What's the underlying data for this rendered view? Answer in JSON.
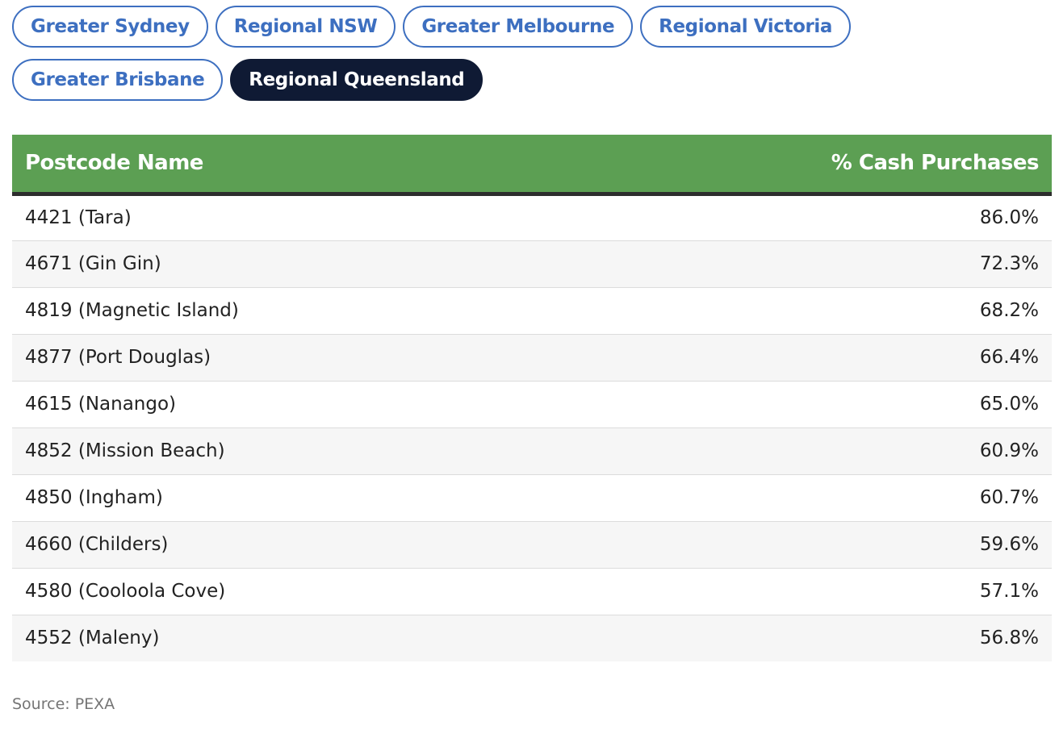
{
  "region_tabs": [
    {
      "label": "Greater Sydney",
      "active": false
    },
    {
      "label": "Regional NSW",
      "active": false
    },
    {
      "label": "Greater Melbourne",
      "active": false
    },
    {
      "label": "Regional Victoria",
      "active": false
    },
    {
      "label": "Greater Brisbane",
      "active": false
    },
    {
      "label": "Regional Queensland",
      "active": true
    }
  ],
  "table": {
    "headers": {
      "postcode_name": "Postcode Name",
      "cash_purchases": "% Cash Purchases"
    },
    "rows": [
      {
        "postcode_name": "4421 (Tara)",
        "cash_purchases": "86.0%"
      },
      {
        "postcode_name": "4671 (Gin Gin)",
        "cash_purchases": "72.3%"
      },
      {
        "postcode_name": "4819 (Magnetic Island)",
        "cash_purchases": "68.2%"
      },
      {
        "postcode_name": "4877 (Port Douglas)",
        "cash_purchases": "66.4%"
      },
      {
        "postcode_name": "4615 (Nanango)",
        "cash_purchases": "65.0%"
      },
      {
        "postcode_name": "4852 (Mission Beach)",
        "cash_purchases": "60.9%"
      },
      {
        "postcode_name": "4850 (Ingham)",
        "cash_purchases": "60.7%"
      },
      {
        "postcode_name": "4660 (Childers)",
        "cash_purchases": "59.6%"
      },
      {
        "postcode_name": "4580 (Cooloola Cove)",
        "cash_purchases": "57.1%"
      },
      {
        "postcode_name": "4552 (Maleny)",
        "cash_purchases": "56.8%"
      }
    ]
  },
  "source": "Source: PEXA",
  "colors": {
    "tab_text": "#3d6fc0",
    "tab_active_bg": "#0f1a34",
    "header_bg": "#5c9f53",
    "header_rule": "#2d2d2d",
    "row_stripe": "#f6f6f6"
  }
}
